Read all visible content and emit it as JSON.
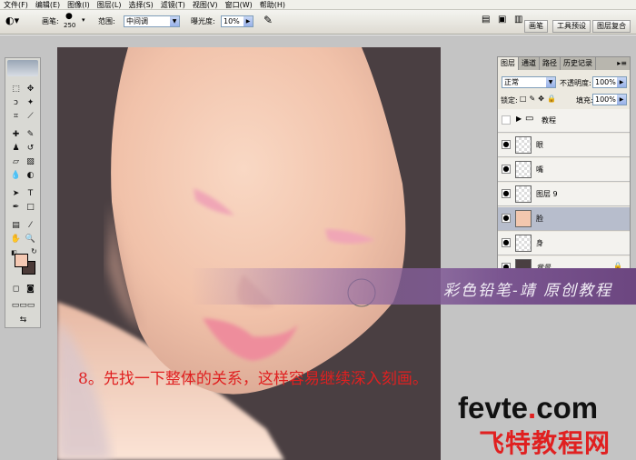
{
  "menu": {
    "items": [
      "文件(F)",
      "编辑(E)",
      "图像(I)",
      "图层(L)",
      "选择(S)",
      "滤镜(T)",
      "视图(V)",
      "窗口(W)",
      "帮助(H)"
    ]
  },
  "options": {
    "brush_label": "画笔:",
    "brush_size": "250",
    "range_label": "范围:",
    "range_value": "中间调",
    "exposure_label": "曝光度:",
    "exposure_value": "10%",
    "tabs": [
      "画笔",
      "工具预设",
      "图层复合"
    ]
  },
  "layers_panel": {
    "tabs": [
      "图层",
      "通道",
      "路径",
      "历史记录"
    ],
    "blend_mode": "正常",
    "opacity_label": "不透明度:",
    "opacity_value": "100%",
    "lock_label": "锁定:",
    "fill_label": "填充:",
    "fill_value": "100%",
    "layers": [
      {
        "name": "教程",
        "type": "group",
        "visible": false
      },
      {
        "name": "眼",
        "type": "layer",
        "visible": true
      },
      {
        "name": "嘴",
        "type": "layer",
        "visible": true
      },
      {
        "name": "图层 9",
        "type": "layer",
        "visible": true
      },
      {
        "name": "脸",
        "type": "layer",
        "visible": true,
        "active": true
      },
      {
        "name": "身",
        "type": "layer",
        "visible": true
      },
      {
        "name": "背景",
        "type": "background",
        "visible": true
      }
    ]
  },
  "overlay": {
    "banner_text": "彩色铅笔-靖 原创教程",
    "step_text": "8。先找一下整体的关系，这样容易继续深入刻画。",
    "watermark_en_a": "fevte",
    "watermark_en_dot": ".",
    "watermark_en_b": "com",
    "watermark_cn": "飞特教程网"
  },
  "colors": {
    "foreground": "#f5c9b3",
    "background": "#4b3a37",
    "canvas_bg": "#4a3f42",
    "step_text": "#e02020"
  }
}
